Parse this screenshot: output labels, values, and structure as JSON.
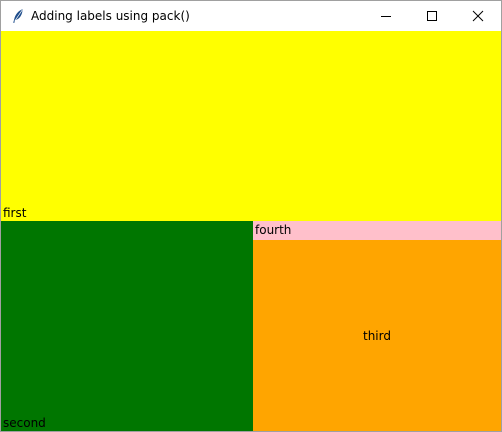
{
  "window": {
    "title": "Adding labels using pack()",
    "icon": "feather-icon"
  },
  "title_controls": {
    "minimize_icon": "minimize-icon",
    "maximize_icon": "maximize-icon",
    "close_icon": "close-icon"
  },
  "labels": {
    "first": {
      "text": "first",
      "color": "#ffff00"
    },
    "second": {
      "text": "second",
      "color": "#007600"
    },
    "fourth": {
      "text": "fourth",
      "color": "#ffc0cb"
    },
    "third": {
      "text": "third",
      "color": "#ffa500"
    }
  }
}
